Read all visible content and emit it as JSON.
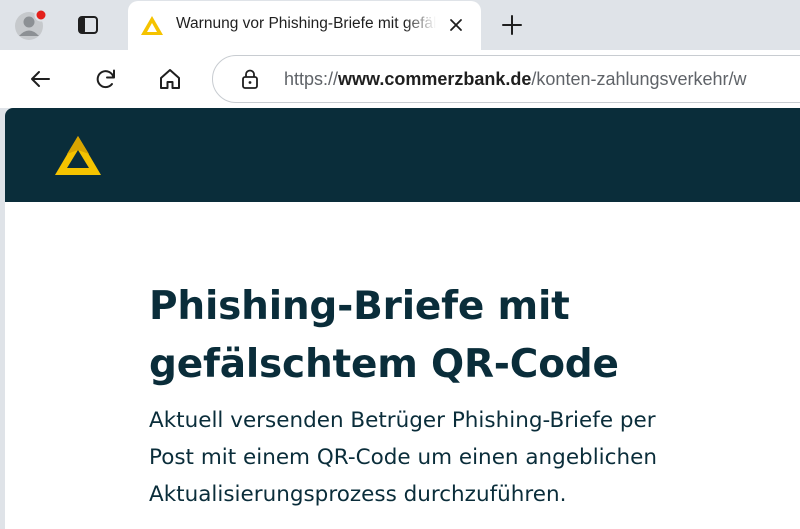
{
  "browser": {
    "tab": {
      "title": "Warnung vor Phishing-Briefe mit gefälschtem QR-Code"
    },
    "address_bar": {
      "url_scheme": "https://",
      "url_host": "www.commerzbank.de",
      "url_path": "/konten-zahlungsverkehr/w"
    },
    "profile_notification_color": "#e3201b",
    "icons": [
      "profile-avatar-icon",
      "tab-actions-icon",
      "commerzbank-favicon",
      "close-icon",
      "plus-icon",
      "back-arrow-icon",
      "reload-icon",
      "home-icon",
      "lock-icon"
    ]
  },
  "site": {
    "brand_colors": {
      "header_bg": "#0a2d3a",
      "logo_yellow": "#f5c300",
      "text": "#0a2d3a"
    }
  },
  "article": {
    "headline_line1": "Phishing-Briefe mit",
    "headline_line2": "gefälschtem QR-Code",
    "lead_line1": "Aktuell versenden Betrüger Phishing-Briefe per",
    "lead_line2": "Post mit einem QR-Code um einen angeblichen",
    "lead_line3": "Aktualisierungsprozess durchzuführen."
  }
}
